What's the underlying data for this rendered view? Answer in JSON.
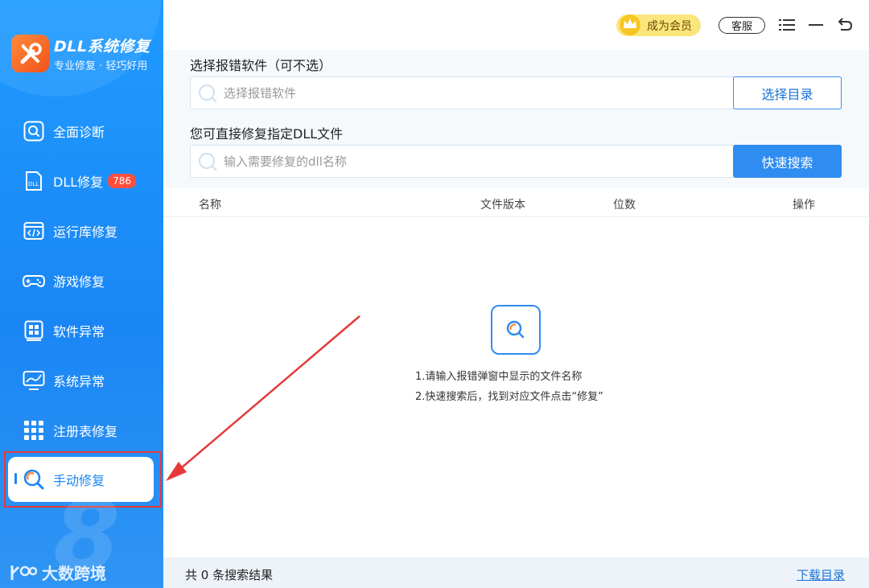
{
  "app": {
    "title": "DLL系统修复",
    "subtitle": "专业修复 · 轻巧好用"
  },
  "sidebar": {
    "items": [
      {
        "label": "全面诊断",
        "icon": "search-icon"
      },
      {
        "label": "DLL修复",
        "icon": "dll-file-icon",
        "badge": "786"
      },
      {
        "label": "运行库修复",
        "icon": "code-window-icon"
      },
      {
        "label": "游戏修复",
        "icon": "gamepad-icon"
      },
      {
        "label": "软件异常",
        "icon": "app-grid-icon"
      },
      {
        "label": "系统异常",
        "icon": "monitor-icon"
      },
      {
        "label": "注册表修复",
        "icon": "registry-grid-icon"
      },
      {
        "label": "手动修复",
        "icon": "manual-search-icon",
        "active": true
      }
    ],
    "watermark": "大数跨境"
  },
  "header": {
    "vip_label": "成为会员",
    "service_label": "客服"
  },
  "main": {
    "select_software_label": "选择报错软件（可不选）",
    "select_software_placeholder": "选择报错软件",
    "select_dir_button": "选择目录",
    "dll_label": "您可直接修复指定DLL文件",
    "dll_placeholder": "输入需要修复的dll名称",
    "search_button": "快速搜索",
    "table_headers": [
      "名称",
      "文件版本",
      "位数",
      "操作"
    ],
    "empty_tips": [
      "1.请输入报错弹窗中显示的文件名称",
      "2.快速搜索后，找到对应文件点击“修复”"
    ],
    "result_count": "共 0 条搜索结果",
    "download_dir_link": "下载目录"
  },
  "colors": {
    "accent": "#2f8cf0",
    "sidebar": "#1a86f5",
    "vip": "#fbe67e",
    "annotation": "#e63a3a"
  }
}
